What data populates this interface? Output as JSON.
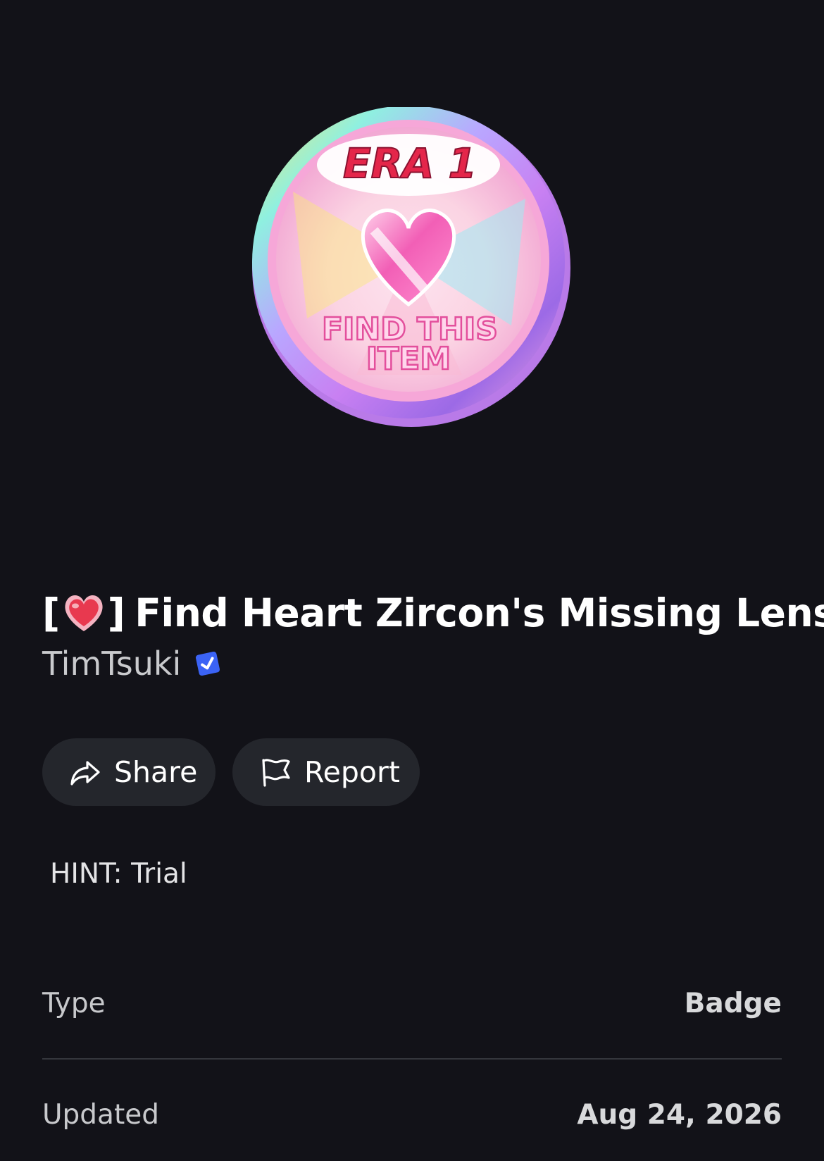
{
  "badge": {
    "image_text_top": "ERA 1",
    "image_text_bottom_1": "FIND THIS",
    "image_text_bottom_2": "ITEM",
    "icon": "heart-emoji",
    "bracket_open": "[",
    "bracket_close": "]",
    "name": "Find Heart Zircon's Missing Lens"
  },
  "creator": {
    "name": "TimTsuki",
    "verified": true,
    "verified_color": "#3b63f5"
  },
  "actions": {
    "share_label": "Share",
    "report_label": "Report"
  },
  "description": "HINT: Trial",
  "details": [
    {
      "label": "Type",
      "value": "Badge"
    },
    {
      "label": "Updated",
      "value": "Aug 24, 2026"
    }
  ],
  "colors": {
    "background": "#121218",
    "button_bg": "#24262c",
    "heart": "#e8394f",
    "badge_pink": "#f06bb7"
  }
}
